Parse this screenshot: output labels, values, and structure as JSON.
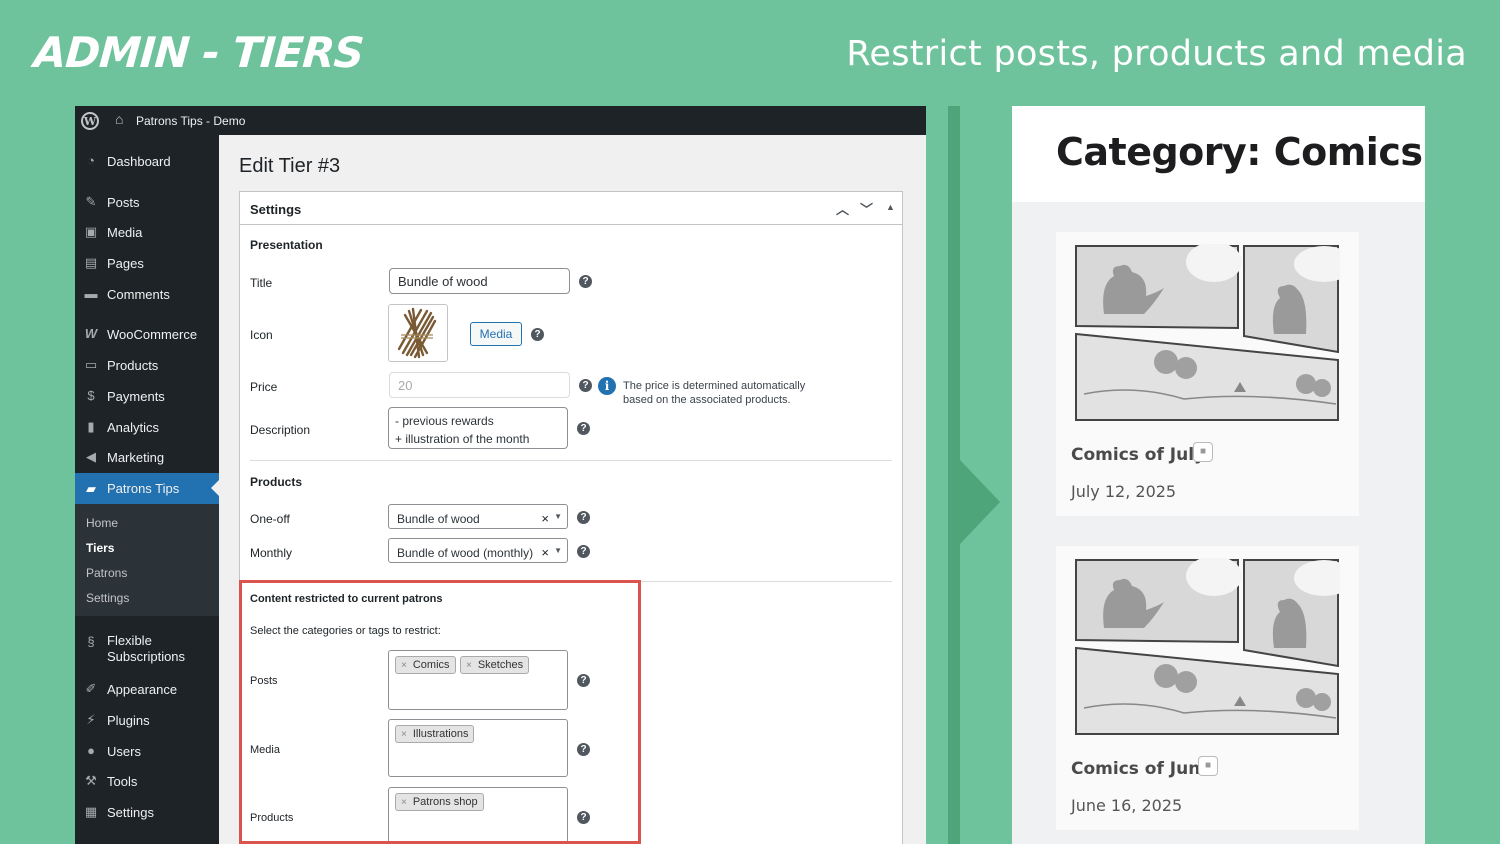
{
  "hero": {
    "title": "ADMIN - TIERS",
    "subtitle": "Restrict posts, products and media"
  },
  "adminbar": {
    "site": "Patrons Tips - Demo"
  },
  "sidebar": {
    "items": [
      {
        "label": "Dashboard",
        "icon": "dashboard-icon"
      },
      {
        "label": "Posts",
        "icon": "pin-icon"
      },
      {
        "label": "Media",
        "icon": "media-icon"
      },
      {
        "label": "Pages",
        "icon": "page-icon"
      },
      {
        "label": "Comments",
        "icon": "comment-icon"
      },
      {
        "label": "WooCommerce",
        "icon": "woo-icon"
      },
      {
        "label": "Products",
        "icon": "archive-icon"
      },
      {
        "label": "Payments",
        "icon": "dollar-icon"
      },
      {
        "label": "Analytics",
        "icon": "chart-icon"
      },
      {
        "label": "Marketing",
        "icon": "megaphone-icon"
      },
      {
        "label": "Patrons Tips",
        "icon": "mug-icon"
      },
      {
        "label": "Flexible",
        "label2": "Subscriptions",
        "icon": "subscriptions-icon"
      },
      {
        "label": "Appearance",
        "icon": "brush-icon"
      },
      {
        "label": "Plugins",
        "icon": "plugin-icon"
      },
      {
        "label": "Users",
        "icon": "user-icon"
      },
      {
        "label": "Tools",
        "icon": "wrench-icon"
      },
      {
        "label": "Settings",
        "icon": "settings-icon"
      }
    ],
    "submenu": [
      "Home",
      "Tiers",
      "Patrons",
      "Settings"
    ]
  },
  "page": {
    "title": "Edit Tier #3",
    "box_title": "Settings",
    "presentation": "Presentation",
    "title_label": "Title",
    "title_value": "Bundle of wood",
    "icon_label": "Icon",
    "media_button": "Media",
    "price_label": "Price",
    "price_value": "20",
    "price_note1": "The price is determined automatically",
    "price_note2": "based on the associated products.",
    "description_label": "Description",
    "description_line1": "- previous rewards",
    "description_line2": "+ illustration of the month",
    "products_section": "Products",
    "oneoff_label": "One-off",
    "oneoff_value": "Bundle of wood",
    "monthly_label": "Monthly",
    "monthly_value": "Bundle of wood (monthly)",
    "restricted_section": "Content restricted to current patrons",
    "restricted_help": "Select the categories or tags to restrict:",
    "posts_label": "Posts",
    "posts_tags": [
      "Comics",
      "Sketches"
    ],
    "media_label": "Media",
    "media_tags": [
      "Illustrations"
    ],
    "products_label": "Products",
    "products_tags": [
      "Patrons shop"
    ],
    "help_glyph": "?",
    "info_glyph": "i",
    "remove_glyph": "×"
  },
  "frontend": {
    "title": "Category: Comics",
    "posts": [
      {
        "name": "Comics of July",
        "date": "July 12, 2025"
      },
      {
        "name": "Comics of June",
        "date": "June 16, 2025"
      }
    ]
  },
  "colors": {
    "accent": "#2271b1",
    "hero_bg": "#6ec29c",
    "highlight": "#d9534f",
    "sidebar": "#1d2327"
  }
}
